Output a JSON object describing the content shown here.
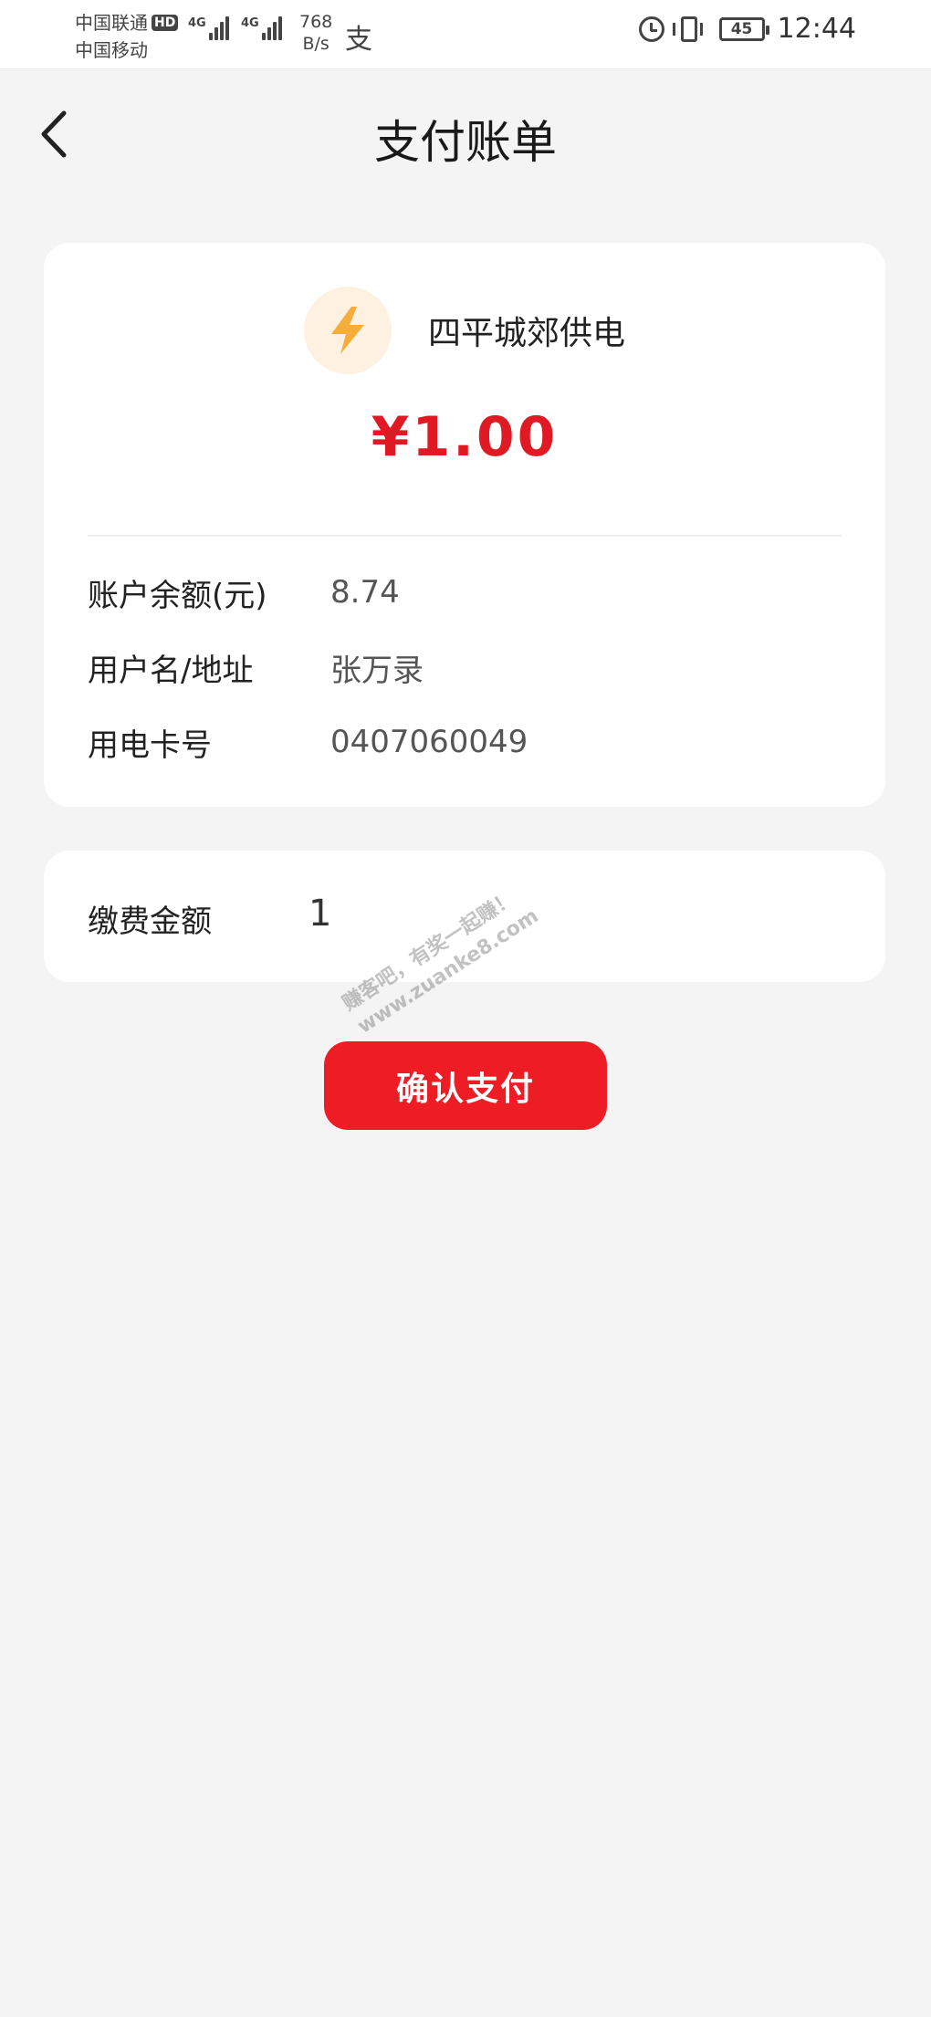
{
  "status_bar": {
    "carrier_1": "中国联通",
    "carrier_1_badge": "HD",
    "carrier_2": "中国移动",
    "network_1": "4G",
    "network_2": "4G",
    "speed_value": "768",
    "speed_unit": "B/s",
    "alipay_glyph": "支",
    "battery": "45",
    "time": "12:44",
    "icons": [
      "alarm-icon",
      "vibrate-icon",
      "battery-icon",
      "signal-icon"
    ]
  },
  "header": {
    "title": "支付账单"
  },
  "bill": {
    "biller_name": "四平城郊供电",
    "amount": "¥1.00",
    "rows": [
      {
        "label": "账户余额(元)",
        "value": "8.74"
      },
      {
        "label": "用户名/地址",
        "value": "张万录"
      },
      {
        "label": "用电卡号",
        "value": "0407060049"
      }
    ]
  },
  "payment": {
    "amount_label": "缴费金额",
    "amount_value": "1"
  },
  "confirm_label": "确认支付",
  "watermark": {
    "line_1": "赚客吧，有奖一起赚！",
    "line_2": "www.zuanke8.com"
  },
  "colors": {
    "accent_red": "#ee1c25",
    "amount_red": "#e01a24",
    "icon_orange": "#f5ae3a",
    "icon_bg": "#fdf1e2",
    "page_bg": "#f4f4f4"
  }
}
